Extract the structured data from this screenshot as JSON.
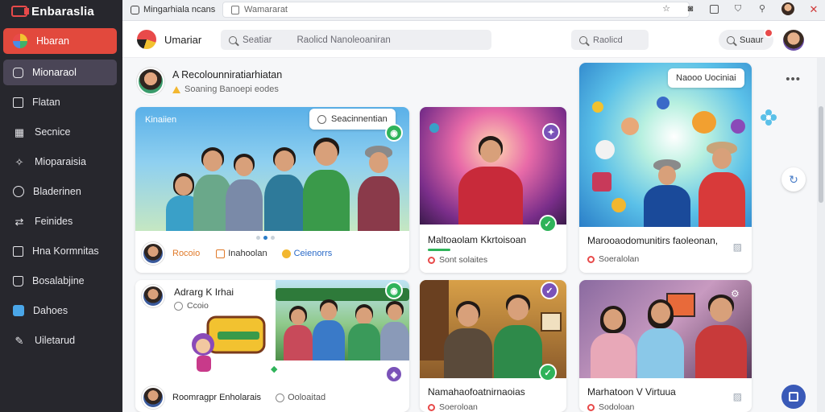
{
  "sidebar": {
    "brand": "Enbaraslia",
    "items": [
      {
        "label": "Hbaran",
        "icon": "color-wheel-icon"
      },
      {
        "label": "Mionaraol",
        "icon": "instagram-icon"
      },
      {
        "label": "Flatan",
        "icon": "square-icon"
      },
      {
        "label": "Secnice",
        "icon": "grid-icon"
      },
      {
        "label": "Mioparaisia",
        "icon": "puzzle-icon"
      },
      {
        "label": "Bladerinen",
        "icon": "info-icon"
      },
      {
        "label": "Feinides",
        "icon": "share-icon"
      },
      {
        "label": "Hna Kormnitas",
        "icon": "document-icon"
      },
      {
        "label": "Bosalabjine",
        "icon": "bag-icon"
      },
      {
        "label": "Dahoes",
        "icon": "calendar-icon"
      },
      {
        "label": "Uiletarud",
        "icon": "pen-icon"
      }
    ]
  },
  "browser": {
    "tab_title": "Mingarhiala ncans",
    "url": "Wamararat"
  },
  "appbar": {
    "title": "Umariar",
    "search_placeholder": "Seatiar",
    "search_hint": "Raolicd Nanoleoaniran",
    "search2_placeholder": "Raolicd",
    "search_button": "Suaur"
  },
  "feed": {
    "title": "A Recolounniratiarhiatan",
    "subtitle": "Soaning Banoepi eodes"
  },
  "cards": {
    "c1": {
      "tag_left": "Kinaiien",
      "tag_right": "Seacinnentian",
      "author": "Rocoio",
      "meta1": "Inahoolan",
      "meta2": "Ceienorrs"
    },
    "c2": {
      "title": "Maltoaolam Kkrtoisoan",
      "sub": "Sont solaites"
    },
    "c3": {
      "tag": "Naooo Uociniai",
      "title": "Marooaodomunitirs faoleonan,",
      "sub": "Soeralolan"
    },
    "c4": {
      "title": "Adrarg K Irhai",
      "sub": "Ccoio",
      "footer_name": "Roomragpr Enholarais",
      "footer_meta": "Ooloaitad"
    },
    "c5": {
      "title": "Namahaofoatnirnaoias",
      "sub": "Soeroloan"
    },
    "c6": {
      "title": "Marhatoon V Virtuua",
      "sub": "Sodoloan"
    }
  },
  "colors": {
    "sidebar_bg": "#27272d",
    "active_red": "#e2493d",
    "active_purple": "#4a4556",
    "badge_green": "#2fb35a",
    "badge_purple": "#7a52b8"
  }
}
